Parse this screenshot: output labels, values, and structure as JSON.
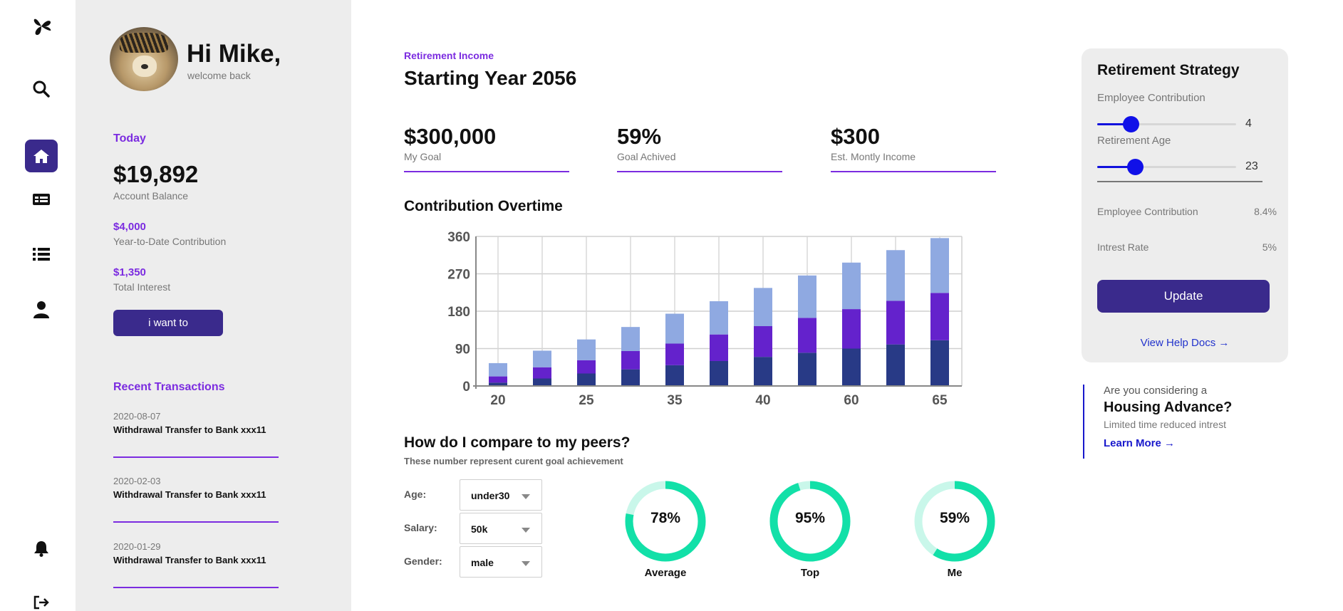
{
  "rail": {
    "items": [
      {
        "icon": "logo-leaf-icon"
      },
      {
        "icon": "search-icon"
      },
      {
        "icon": "home-icon",
        "active": true
      },
      {
        "icon": "table-icon"
      },
      {
        "icon": "list-icon"
      },
      {
        "icon": "user-icon"
      },
      {
        "icon": "bell-icon"
      },
      {
        "icon": "logout-icon"
      }
    ]
  },
  "profile": {
    "greeting": "Hi Mike,",
    "subtitle": "welcome back"
  },
  "account": {
    "today_label": "Today",
    "balance": "$19,892",
    "balance_label": "Account Balance",
    "ytd_value": "$4,000",
    "ytd_label": "Year-to-Date Contribution",
    "interest_value": "$1,350",
    "interest_label": "Total Interest",
    "action_button": "i want to"
  },
  "transactions": {
    "title": "Recent Transactions",
    "items": [
      {
        "date": "2020-08-07",
        "description": "Withdrawal Transfer to Bank xxx11"
      },
      {
        "date": "2020-02-03",
        "description": "Withdrawal Transfer to Bank xxx11"
      },
      {
        "date": "2020-01-29",
        "description": "Withdrawal Transfer to Bank xxx11"
      }
    ]
  },
  "main": {
    "kicker": "Retirement Income",
    "title": "Starting Year 2056",
    "kpis": [
      {
        "value": "$300,000",
        "label": "My Goal"
      },
      {
        "value": "59%",
        "label": "Goal Achived"
      },
      {
        "value": "$300",
        "label": "Est. Montly Income"
      }
    ],
    "chart_title": "Contribution Overtime"
  },
  "chart_data": {
    "type": "bar",
    "stacked": true,
    "categories": [
      "20",
      "",
      "25",
      "",
      "35",
      "",
      "40",
      "",
      "60",
      "",
      "65"
    ],
    "series": [
      {
        "values": [
          8,
          18,
          30,
          40,
          50,
          60,
          70,
          80,
          90,
          100,
          110
        ],
        "color": "#283a86"
      },
      {
        "values": [
          15,
          27,
          32,
          44,
          52,
          64,
          74,
          84,
          95,
          105,
          114
        ],
        "color": "#6422cc"
      },
      {
        "values": [
          32,
          40,
          50,
          58,
          72,
          80,
          92,
          102,
          112,
          122,
          132
        ],
        "color": "#8fa9e1"
      }
    ],
    "ylim": [
      0,
      360
    ],
    "yticks": [
      0,
      90,
      180,
      270,
      360
    ],
    "grid": true,
    "title": "",
    "xlabel": "",
    "ylabel": ""
  },
  "peers": {
    "title": "How do I compare to my peers?",
    "subtitle": "These number represent curent goal achievement",
    "filters": [
      {
        "label": "Age:",
        "value": "under30"
      },
      {
        "label": "Salary:",
        "value": "50k"
      },
      {
        "label": "Gender:",
        "value": "male"
      }
    ],
    "gauges": [
      {
        "value": "78%",
        "fraction": 0.78,
        "label": "Average"
      },
      {
        "value": "95%",
        "fraction": 0.95,
        "label": "Top"
      },
      {
        "value": "59%",
        "fraction": 0.59,
        "label": "Me"
      }
    ],
    "gauge_color": "#12e0a8",
    "gauge_track_color": "#c9f7ea"
  },
  "strategy": {
    "title": "Retirement Strategy",
    "contribution_label": "Employee Contribution",
    "contribution_value": "4",
    "contribution_fraction": 0.24,
    "age_label": "Retirement Age",
    "age_value": "23",
    "age_fraction": 0.27,
    "rows": [
      {
        "label": "Employee Contribution",
        "value": "8.4%"
      },
      {
        "label": "Intrest Rate",
        "value": "5%"
      }
    ],
    "update_button": "Update",
    "help_link": "View Help Docs →"
  },
  "promo": {
    "kicker": "Are you considering a",
    "title": "Housing Advance?",
    "subtitle": "Limited time reduced intrest",
    "link": "Learn More →"
  },
  "colors": {
    "accent": "#7b2be0",
    "primary": "#3a2a8c",
    "link": "#1818cc"
  }
}
